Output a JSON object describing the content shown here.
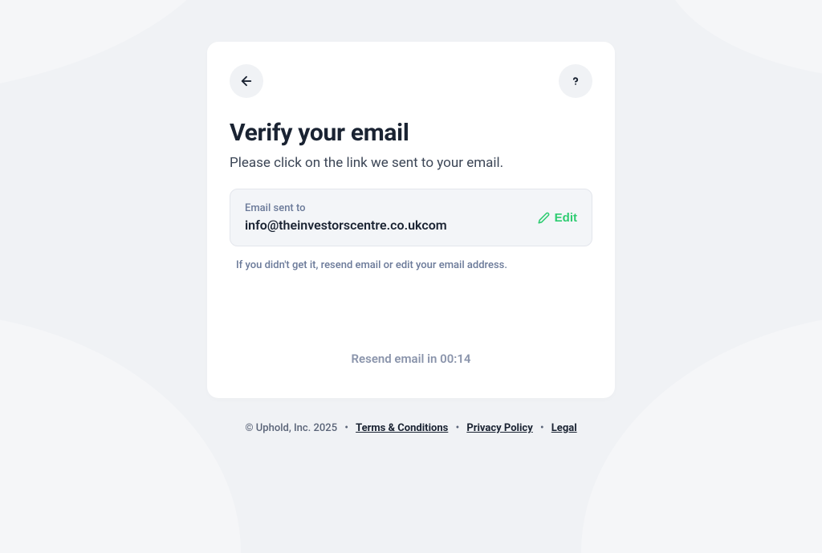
{
  "card": {
    "title": "Verify your email",
    "subtitle": "Please click on the link we sent to your email.",
    "email_box": {
      "label": "Email sent to",
      "email": "info@theinvestorscentre.co.ukcom",
      "edit_label": "Edit"
    },
    "help_text": "If you didn't get it, resend email or edit your email address.",
    "resend_prefix": "Resend email in ",
    "resend_time": "00:14"
  },
  "footer": {
    "copyright": "© Uphold, Inc. 2025",
    "links": {
      "terms": "Terms & Conditions",
      "privacy": "Privacy Policy",
      "legal": "Legal"
    }
  }
}
